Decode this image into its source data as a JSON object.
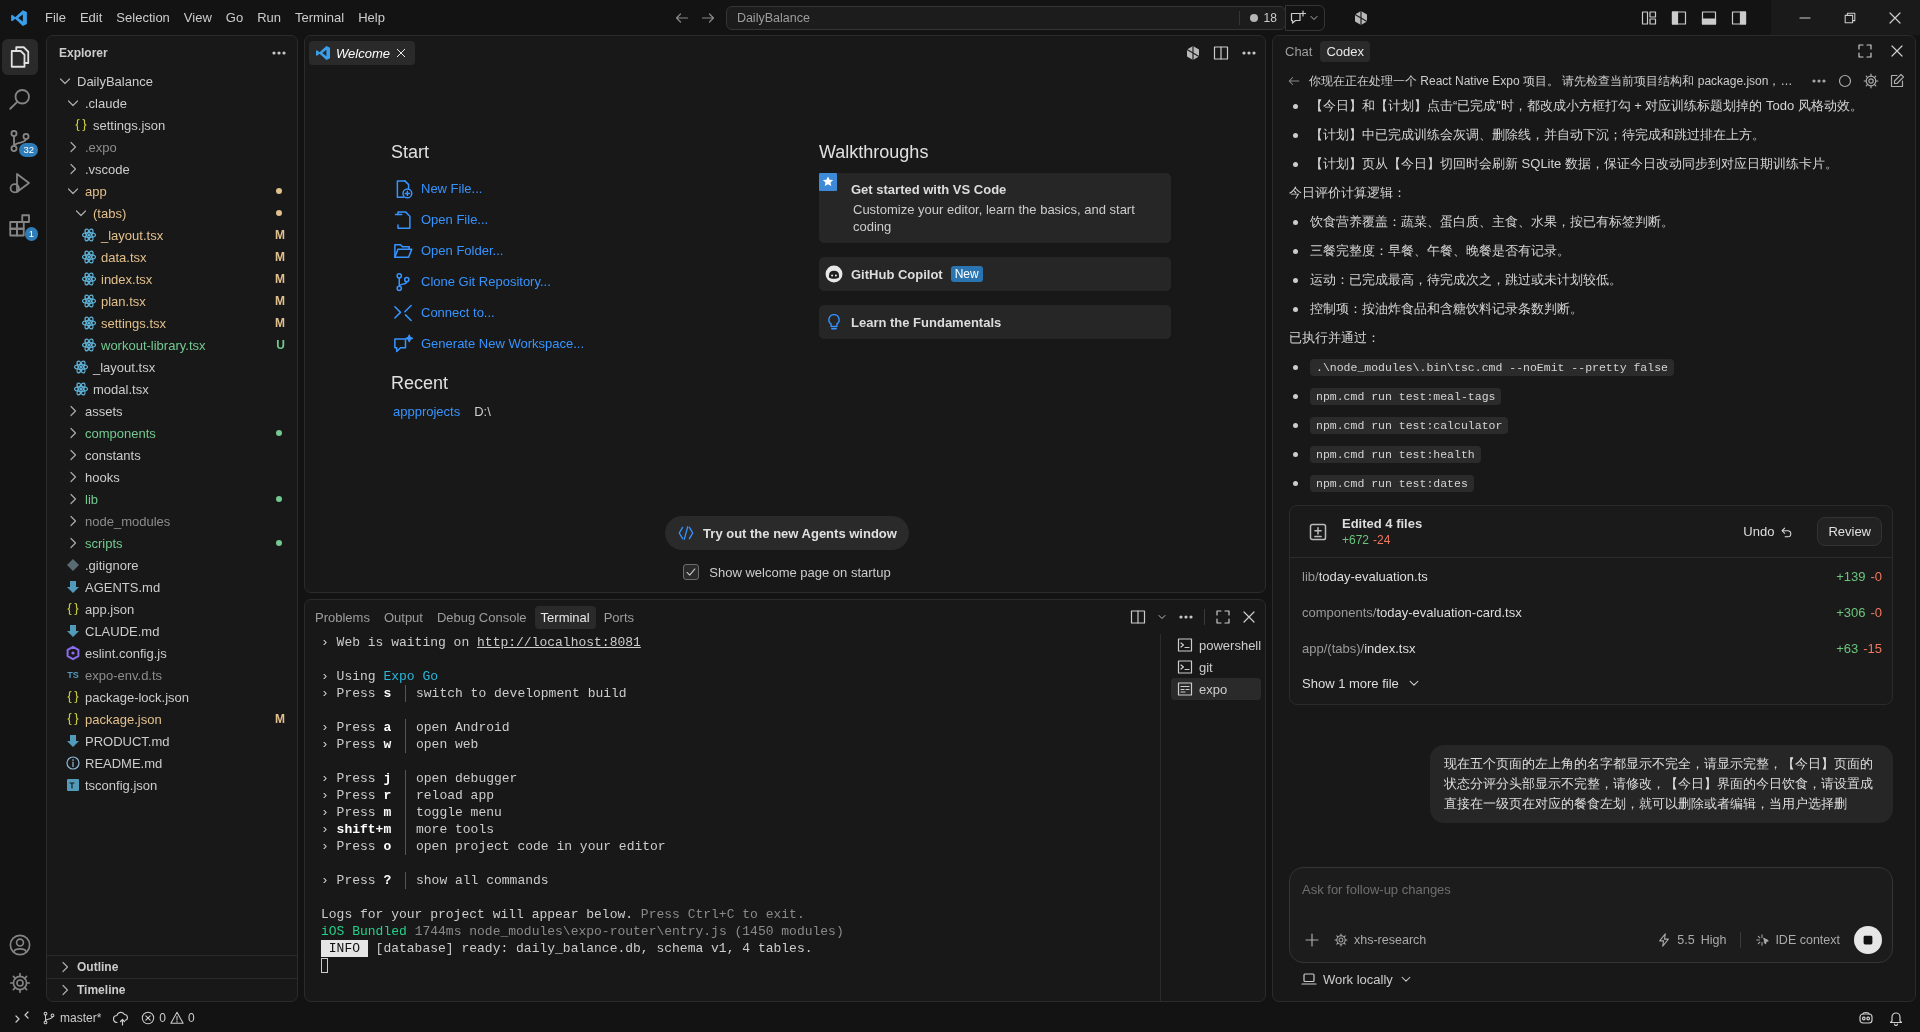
{
  "title_bar": {
    "menu": [
      "File",
      "Edit",
      "Selection",
      "View",
      "Go",
      "Run",
      "Terminal",
      "Help"
    ],
    "command_center": "DailyBalance",
    "notifications": "18"
  },
  "activity_bar": {
    "items": [
      {
        "kind": "explorer",
        "selected": true
      },
      {
        "kind": "search",
        "selected": false
      },
      {
        "kind": "source_control",
        "selected": false,
        "badge": "32"
      },
      {
        "kind": "run",
        "selected": false
      },
      {
        "kind": "extensions",
        "selected": false,
        "badge": "1"
      }
    ]
  },
  "explorer": {
    "title": "Explorer",
    "tree": [
      {
        "label": "DailyBalance",
        "kind": "folder",
        "expanded": true,
        "color": "#cccccc",
        "children": [
          {
            "label": ".claude",
            "kind": "folder",
            "expanded": true,
            "color": "#cccccc",
            "children": [
              {
                "label": "settings.json",
                "kind": "json",
                "color": "#cccccc"
              }
            ]
          },
          {
            "label": ".expo",
            "kind": "folder",
            "expanded": false,
            "color": "#8c8c8c"
          },
          {
            "label": ".vscode",
            "kind": "folder",
            "expanded": false,
            "color": "#cccccc"
          },
          {
            "label": "app",
            "kind": "folder",
            "expanded": true,
            "color": "#e2c08d",
            "dot": true,
            "children": [
              {
                "label": "(tabs)",
                "kind": "folder",
                "expanded": true,
                "color": "#e2c08d",
                "dot": true,
                "children": [
                  {
                    "label": "_layout.tsx",
                    "kind": "react",
                    "color": "#e2c08d",
                    "badge": "M"
                  },
                  {
                    "label": "data.tsx",
                    "kind": "react",
                    "color": "#e2c08d",
                    "badge": "M"
                  },
                  {
                    "label": "index.tsx",
                    "kind": "react",
                    "color": "#e2c08d",
                    "badge": "M"
                  },
                  {
                    "label": "plan.tsx",
                    "kind": "react",
                    "color": "#e2c08d",
                    "badge": "M"
                  },
                  {
                    "label": "settings.tsx",
                    "kind": "react",
                    "color": "#e2c08d",
                    "badge": "M"
                  },
                  {
                    "label": "workout-library.tsx",
                    "kind": "react",
                    "color": "#73c991",
                    "badge": "U"
                  }
                ]
              },
              {
                "label": "_layout.tsx",
                "kind": "react",
                "color": "#cccccc"
              },
              {
                "label": "modal.tsx",
                "kind": "react",
                "color": "#cccccc"
              }
            ]
          },
          {
            "label": "assets",
            "kind": "folder",
            "expanded": false,
            "color": "#cccccc"
          },
          {
            "label": "components",
            "kind": "folder",
            "expanded": false,
            "color": "#73c991",
            "dot": true
          },
          {
            "label": "constants",
            "kind": "folder",
            "expanded": false,
            "color": "#cccccc"
          },
          {
            "label": "hooks",
            "kind": "folder",
            "expanded": false,
            "color": "#cccccc"
          },
          {
            "label": "lib",
            "kind": "folder",
            "expanded": false,
            "color": "#73c991",
            "dot": true
          },
          {
            "label": "node_modules",
            "kind": "folder",
            "expanded": false,
            "color": "#8c8c8c"
          },
          {
            "label": "scripts",
            "kind": "folder",
            "expanded": false,
            "color": "#73c991",
            "dot": true
          },
          {
            "label": ".gitignore",
            "kind": "git",
            "color": "#cccccc"
          },
          {
            "label": "AGENTS.md",
            "kind": "md",
            "color": "#cccccc"
          },
          {
            "label": "app.json",
            "kind": "json",
            "color": "#cccccc"
          },
          {
            "label": "CLAUDE.md",
            "kind": "md",
            "color": "#cccccc"
          },
          {
            "label": "eslint.config.js",
            "kind": "eslint",
            "color": "#cccccc"
          },
          {
            "label": "expo-env.d.ts",
            "kind": "ts",
            "icon_text": "TS",
            "color": "#8c8c8c"
          },
          {
            "label": "package-lock.json",
            "kind": "json",
            "color": "#cccccc"
          },
          {
            "label": "package.json",
            "kind": "json",
            "color": "#e2c08d",
            "badge": "M"
          },
          {
            "label": "PRODUCT.md",
            "kind": "md",
            "color": "#cccccc"
          },
          {
            "label": "README.md",
            "kind": "info",
            "color": "#cccccc"
          },
          {
            "label": "tsconfig.json",
            "kind": "tsconfig",
            "color": "#cccccc"
          }
        ]
      }
    ],
    "sections": [
      {
        "label": "Outline",
        "expanded": false
      },
      {
        "label": "Timeline",
        "expanded": false
      }
    ]
  },
  "editor": {
    "tabs": [
      {
        "label": "Welcome",
        "selected": true
      }
    ],
    "start": {
      "heading": "Start",
      "actions": [
        {
          "kind": "new_file",
          "label": "New File..."
        },
        {
          "kind": "open_file",
          "label": "Open File..."
        },
        {
          "kind": "open_folder",
          "label": "Open Folder..."
        },
        {
          "kind": "clone",
          "label": "Clone Git Repository..."
        },
        {
          "kind": "connect",
          "label": "Connect to..."
        },
        {
          "kind": "generate",
          "label": "Generate New Workspace..."
        }
      ]
    },
    "recent": {
      "heading": "Recent",
      "items": [
        {
          "name": "appprojects",
          "path": "D:\\"
        }
      ]
    },
    "walkthroughs": {
      "heading": "Walkthroughs",
      "items": [
        {
          "kind": "featured",
          "title": "Get started with VS Code",
          "description": "Customize your editor, learn the basics, and start coding"
        },
        {
          "kind": "copilot",
          "title": "GitHub Copilot",
          "badge": "New"
        },
        {
          "kind": "bulb",
          "title": "Learn the Fundamentals"
        }
      ]
    },
    "agents_button": "Try out the new Agents window",
    "startup_checkbox": {
      "label": "Show welcome page on startup",
      "checked": true
    }
  },
  "panel": {
    "tabs": [
      {
        "label": "Problems",
        "selected": false
      },
      {
        "label": "Output",
        "selected": false
      },
      {
        "label": "Debug Console",
        "selected": false
      },
      {
        "label": "Terminal",
        "selected": true
      },
      {
        "label": "Ports",
        "selected": false
      }
    ],
    "terminal_lines": [
      {
        "kind": "text",
        "segments": [
          {
            "text": "› Web is waiting on ",
            "kind": "plain"
          },
          {
            "text": "http://localhost:8081",
            "kind": "link"
          }
        ]
      },
      {
        "kind": "text",
        "gap": true,
        "segments": [
          {
            "text": "› Using ",
            "kind": "plain"
          },
          {
            "text": "Expo Go",
            "kind": "accent"
          }
        ]
      },
      {
        "kind": "command",
        "key": "› Press **s**",
        "desc": "switch to development build"
      },
      {
        "kind": "command",
        "gap": true,
        "key": "› Press **a**",
        "desc": "open Android"
      },
      {
        "kind": "command",
        "key": "› Press **w**",
        "desc": "open web"
      },
      {
        "kind": "command",
        "gap": true,
        "key": "› Press **j**",
        "desc": "open debugger"
      },
      {
        "kind": "command",
        "key": "› Press **r**",
        "desc": "reload app"
      },
      {
        "kind": "command",
        "key": "› Press **m**",
        "desc": "toggle menu"
      },
      {
        "kind": "command",
        "key": "› **shift+m**",
        "desc": "more tools"
      },
      {
        "kind": "command",
        "key": "› Press **o**",
        "desc": "open project code in your editor"
      },
      {
        "kind": "command",
        "gap": true,
        "key": "› Press **?**",
        "desc": "show all commands"
      },
      {
        "kind": "text",
        "gap": true,
        "segments": [
          {
            "text": "Logs for your project will appear below. ",
            "kind": "plain"
          },
          {
            "text": "Press Ctrl+C to exit.",
            "kind": "dim"
          }
        ]
      },
      {
        "kind": "text",
        "segments": [
          {
            "text": "iOS Bundled",
            "kind": "success"
          },
          {
            "text": " 1744ms node_modules\\expo-router\\entry.js (1450 modules)",
            "kind": "dim"
          }
        ]
      },
      {
        "kind": "text",
        "segments": [
          {
            "text": " INFO ",
            "kind": "badge"
          },
          {
            "text": " [database] ready: daily_balance.db, schema v1, 4 tables.",
            "kind": "plain"
          }
        ]
      }
    ],
    "terminals": [
      {
        "label": "powershell",
        "selected": false
      },
      {
        "label": "git",
        "selected": false
      },
      {
        "label": "expo",
        "selected": true
      }
    ]
  },
  "chat": {
    "tabs": [
      {
        "label": "Chat",
        "selected": false
      },
      {
        "label": "Codex",
        "selected": true
      }
    ],
    "thread_title": "你现在正在处理一个 React Native Expo 项目。 请先检查当前项目结构和 package.json，…",
    "blocks": [
      {
        "kind": "bullets",
        "items": [
          "【今日】和【计划】点击“已完成”时，都改成小方框打勾 + 对应训练标题划掉的 Todo 风格动效。",
          "【计划】中已完成训练会灰调、删除线，并自动下沉；待完成和跳过排在上方。",
          "【计划】页从【今日】切回时会刷新 SQLite 数据，保证今日改动同步到对应日期训练卡片。"
        ]
      },
      {
        "kind": "para",
        "text": "今日评价计算逻辑："
      },
      {
        "kind": "bullets",
        "items": [
          "饮食营养覆盖：蔬菜、蛋白质、主食、水果，按已有标签判断。",
          "三餐完整度：早餐、午餐、晚餐是否有记录。",
          "运动：已完成最高，待完成次之，跳过或未计划较低。",
          "控制项：按油炸食品和含糖饮料记录条数判断。"
        ]
      },
      {
        "kind": "para",
        "text": "已执行并通过："
      },
      {
        "kind": "code_bullets",
        "items": [
          ".\\node_modules\\.bin\\tsc.cmd --noEmit --pretty false",
          "npm.cmd run test:meal-tags",
          "npm.cmd run test:calculator",
          "npm.cmd run test:health",
          "npm.cmd run test:dates"
        ]
      }
    ],
    "edits": {
      "title": "Edited 4 files",
      "added": "+672",
      "removed": "-24",
      "undo": "Undo",
      "review": "Review",
      "files": [
        {
          "dir": "lib/",
          "name": "today-evaluation.ts",
          "added": "+139",
          "removed": "-0"
        },
        {
          "dir": "components/",
          "name": "today-evaluation-card.tsx",
          "added": "+306",
          "removed": "-0"
        },
        {
          "dir": "app/(tabs)/",
          "name": "index.tsx",
          "added": "+63",
          "removed": "-15"
        }
      ],
      "show_more": "Show 1 more file"
    },
    "user_message": "现在五个页面的左上角的名字都显示不完全，请显示完整，【今日】页面的状态分评分头部显示不完整，请修改，【今日】界面的今日饮食，请设置成直接在一级页在对应的餐食左划，就可以删除或者编辑，当用户选择删",
    "input": {
      "placeholder": "Ask for follow-up changes",
      "agent": "xhs-research",
      "model": "5.5",
      "effort": "High",
      "context": "IDE context"
    },
    "work_mode": "Work locally"
  },
  "status_bar": {
    "branch": "master*",
    "errors": "0",
    "warnings": "0"
  }
}
